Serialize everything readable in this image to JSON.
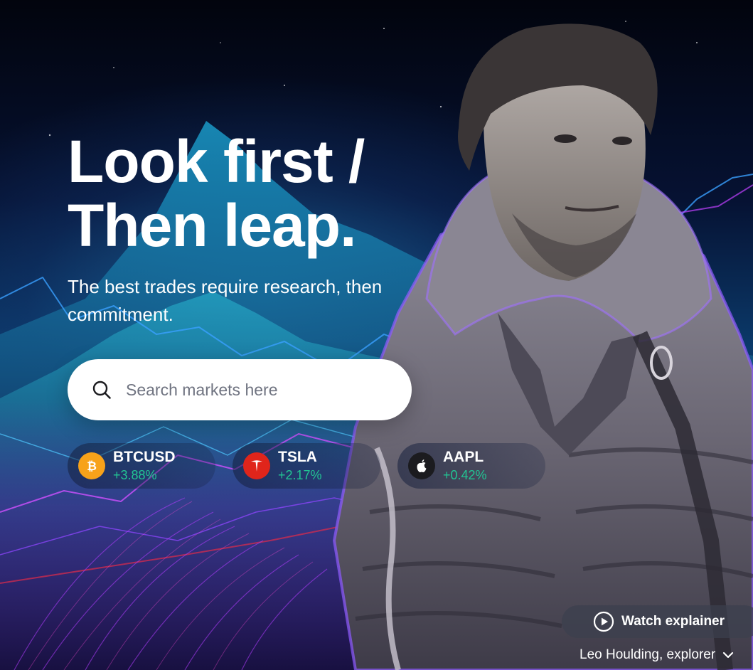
{
  "hero": {
    "headline_line1": "Look first /",
    "headline_line2": "Then leap.",
    "subtitle": "The best trades require research, then commitment."
  },
  "search": {
    "placeholder": "Search markets here",
    "icon": "search-icon"
  },
  "tickers": [
    {
      "symbol": "BTCUSD",
      "change": "+3.88%",
      "icon": "bitcoin-icon",
      "icon_color": "#f7a21a"
    },
    {
      "symbol": "TSLA",
      "change": "+2.17%",
      "icon": "tesla-icon",
      "icon_color": "#e0251b"
    },
    {
      "symbol": "AAPL",
      "change": "+0.42%",
      "icon": "apple-icon",
      "icon_color": "#1b1b1f"
    }
  ],
  "watch_button": {
    "label": "Watch explainer",
    "icon": "play-icon"
  },
  "caption": {
    "label": "Leo Houlding, explorer",
    "icon": "chevron-down-icon"
  },
  "colors": {
    "positive_change": "#22c493",
    "search_bg": "#ffffff",
    "text_primary": "#ffffff"
  }
}
